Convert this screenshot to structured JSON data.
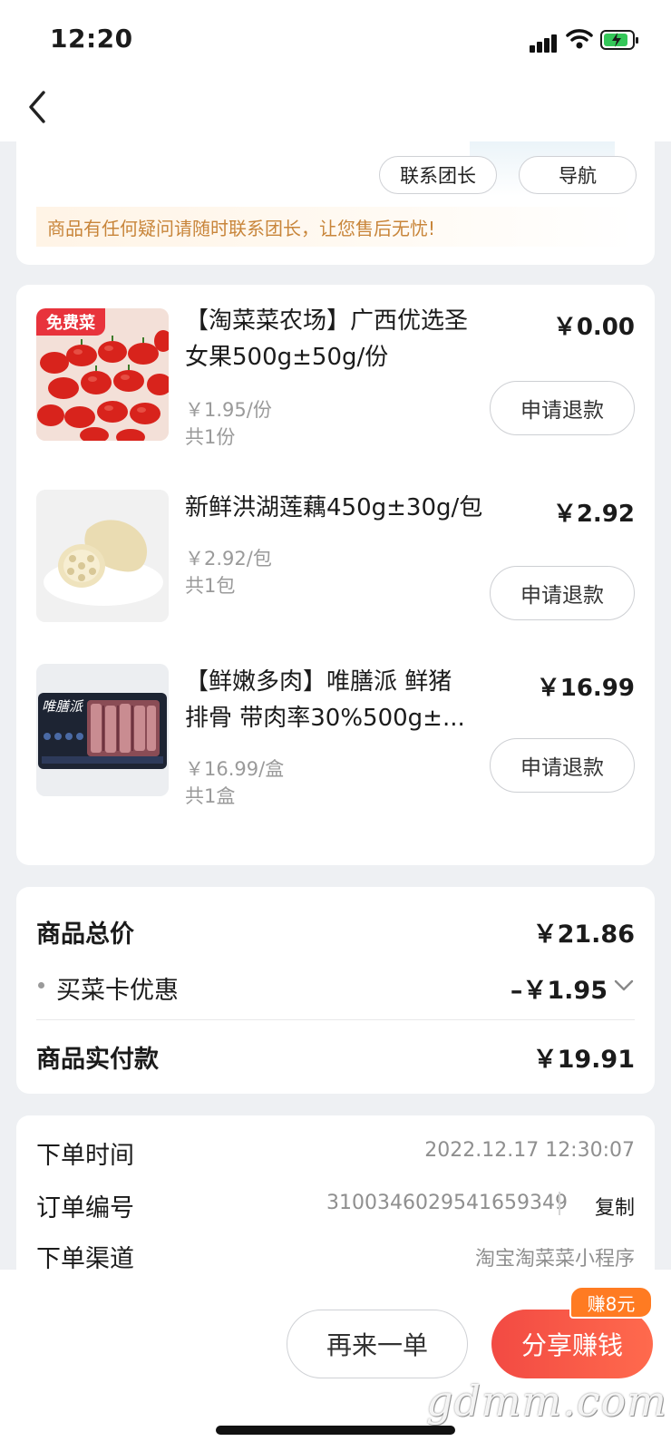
{
  "status": {
    "time": "12:20"
  },
  "leader": {
    "contact_label": "联系团长",
    "navigate_label": "导航",
    "notice": "商品有任何疑问请随时联系团长，让您售后无忧!"
  },
  "products": [
    {
      "badge": "免费菜",
      "name_line1": "【淘菜菜农场】广西优选圣",
      "name_line2": "女果500g±50g/份",
      "price": "￥0.00",
      "unit_price": "￥1.95/份",
      "qty": "共1份",
      "refund_label": "申请退款"
    },
    {
      "name_line1": "新鲜洪湖莲藕450g±30g/包",
      "price": "￥2.92",
      "unit_price": "￥2.92/包",
      "qty": "共1包",
      "refund_label": "申请退款"
    },
    {
      "name_line1": "【鲜嫩多肉】唯膳派 鲜猪",
      "name_line2": "排骨 带肉率30%500g±...",
      "price": "￥16.99",
      "unit_price": "￥16.99/盒",
      "qty": "共1盒",
      "refund_label": "申请退款",
      "pack_brand": "唯膳派"
    }
  ],
  "summary": {
    "total_label": "商品总价",
    "total_value": "￥21.86",
    "discount_label": "买菜卡优惠",
    "discount_value": "–￥1.95",
    "paid_label": "商品实付款",
    "paid_value": "￥19.91"
  },
  "order_info": {
    "time_label": "下单时间",
    "time_value": "2022.12.17 12:30:07",
    "number_label": "订单编号",
    "number_value": "3100346029541659349",
    "copy_label": "复制",
    "channel_label": "下单渠道",
    "channel_value": "淘宝淘菜菜小程序"
  },
  "actions": {
    "reorder_label": "再来一单",
    "share_label": "分享赚钱",
    "earn_badge": "赚8元"
  },
  "watermark": "gdmm.com",
  "colors": {
    "accent": "#f24a43",
    "badge": "#ff7b22",
    "notice_text": "#c8853a",
    "free_badge": "#e8333c"
  }
}
